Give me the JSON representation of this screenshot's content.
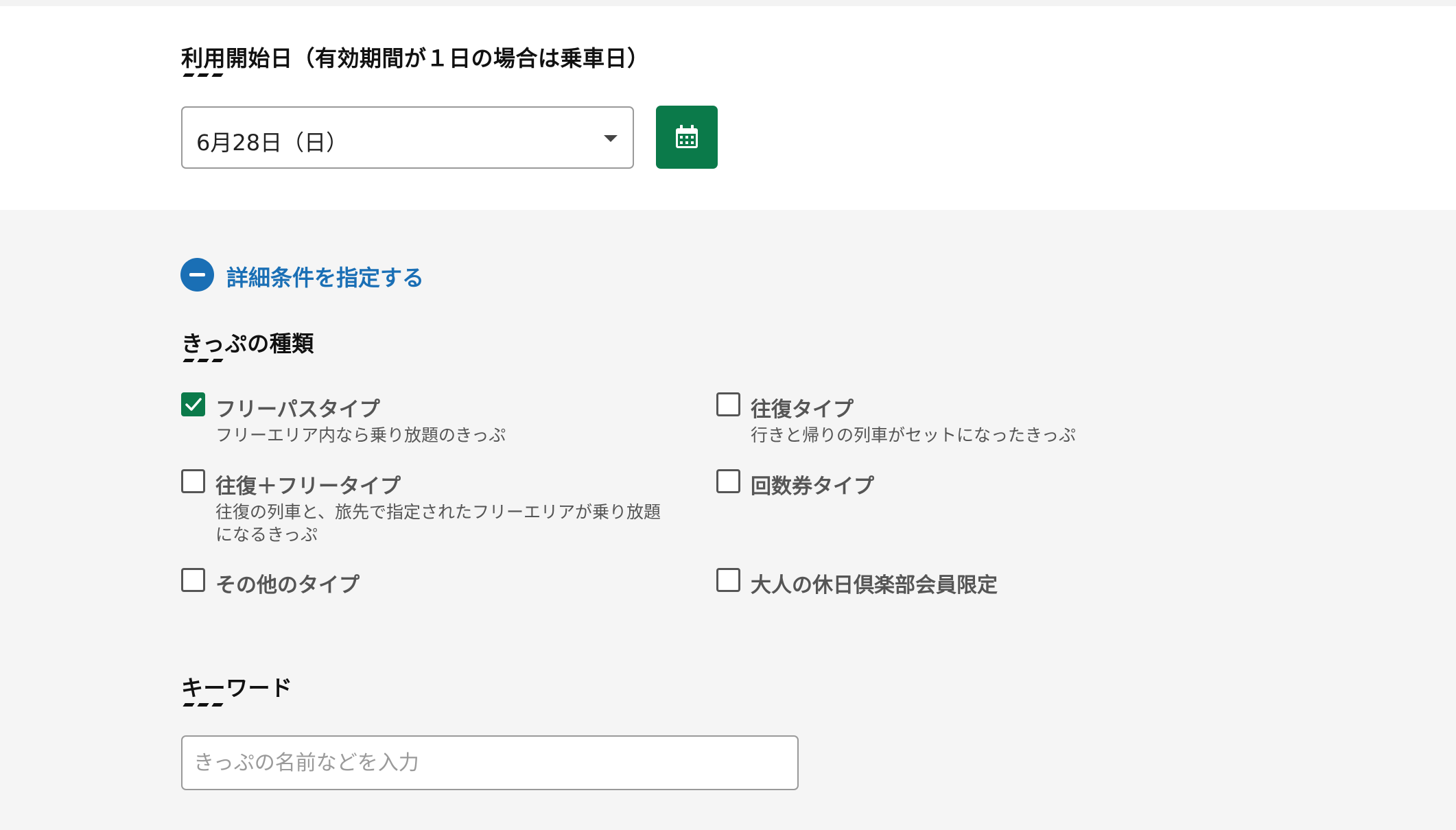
{
  "start_date": {
    "heading": "利用開始日（有効期間が１日の場合は乗車日）",
    "selected_value": "6月28日（日）",
    "calendar_icon": "calendar-icon"
  },
  "details_toggle": {
    "label": "詳細条件を指定する",
    "icon": "minus-circle-icon"
  },
  "ticket_types": {
    "heading": "きっぷの種類",
    "options": [
      {
        "label": "フリーパスタイプ",
        "desc": "フリーエリア内なら乗り放題のきっぷ",
        "checked": true
      },
      {
        "label": "往復タイプ",
        "desc": "行きと帰りの列車がセットになったきっぷ",
        "checked": false
      },
      {
        "label": "往復＋フリータイプ",
        "desc_line1": "往復の列車と、旅先で指定されたフリーエリアが乗り放題",
        "desc_line2": "になるきっぷ",
        "checked": false
      },
      {
        "label": "回数券タイプ",
        "checked": false
      },
      {
        "label": "その他のタイプ",
        "checked": false
      },
      {
        "label": "大人の休日倶楽部会員限定",
        "checked": false
      }
    ]
  },
  "keyword": {
    "heading": "キーワード",
    "placeholder": "きっぷの名前などを入力",
    "value": ""
  },
  "colors": {
    "accent_green": "#0b7a4a",
    "link_blue": "#1a6fb5"
  }
}
